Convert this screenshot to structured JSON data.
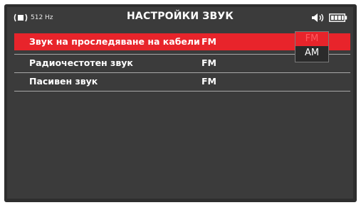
{
  "status_bar": {
    "frequency": "512 Hz",
    "title": "НАСТРОЙКИ ЗВУК",
    "icons": [
      "signal-icon",
      "speaker-icon",
      "battery-icon"
    ]
  },
  "settings": [
    {
      "label": "Звук на проследяване на кабели",
      "value": "FM",
      "selected": true
    },
    {
      "label": "Радиочестотен звук",
      "value": "FM",
      "selected": false
    },
    {
      "label": "Пасивен звук",
      "value": "FM",
      "selected": false
    }
  ],
  "dropdown": {
    "options": [
      "FM",
      "AM"
    ],
    "selected": "FM"
  },
  "colors": {
    "screen_bg": "#3b3b3b",
    "highlight": "#e8242b",
    "text": "#ffffff",
    "divider": "#a8a8a8"
  }
}
